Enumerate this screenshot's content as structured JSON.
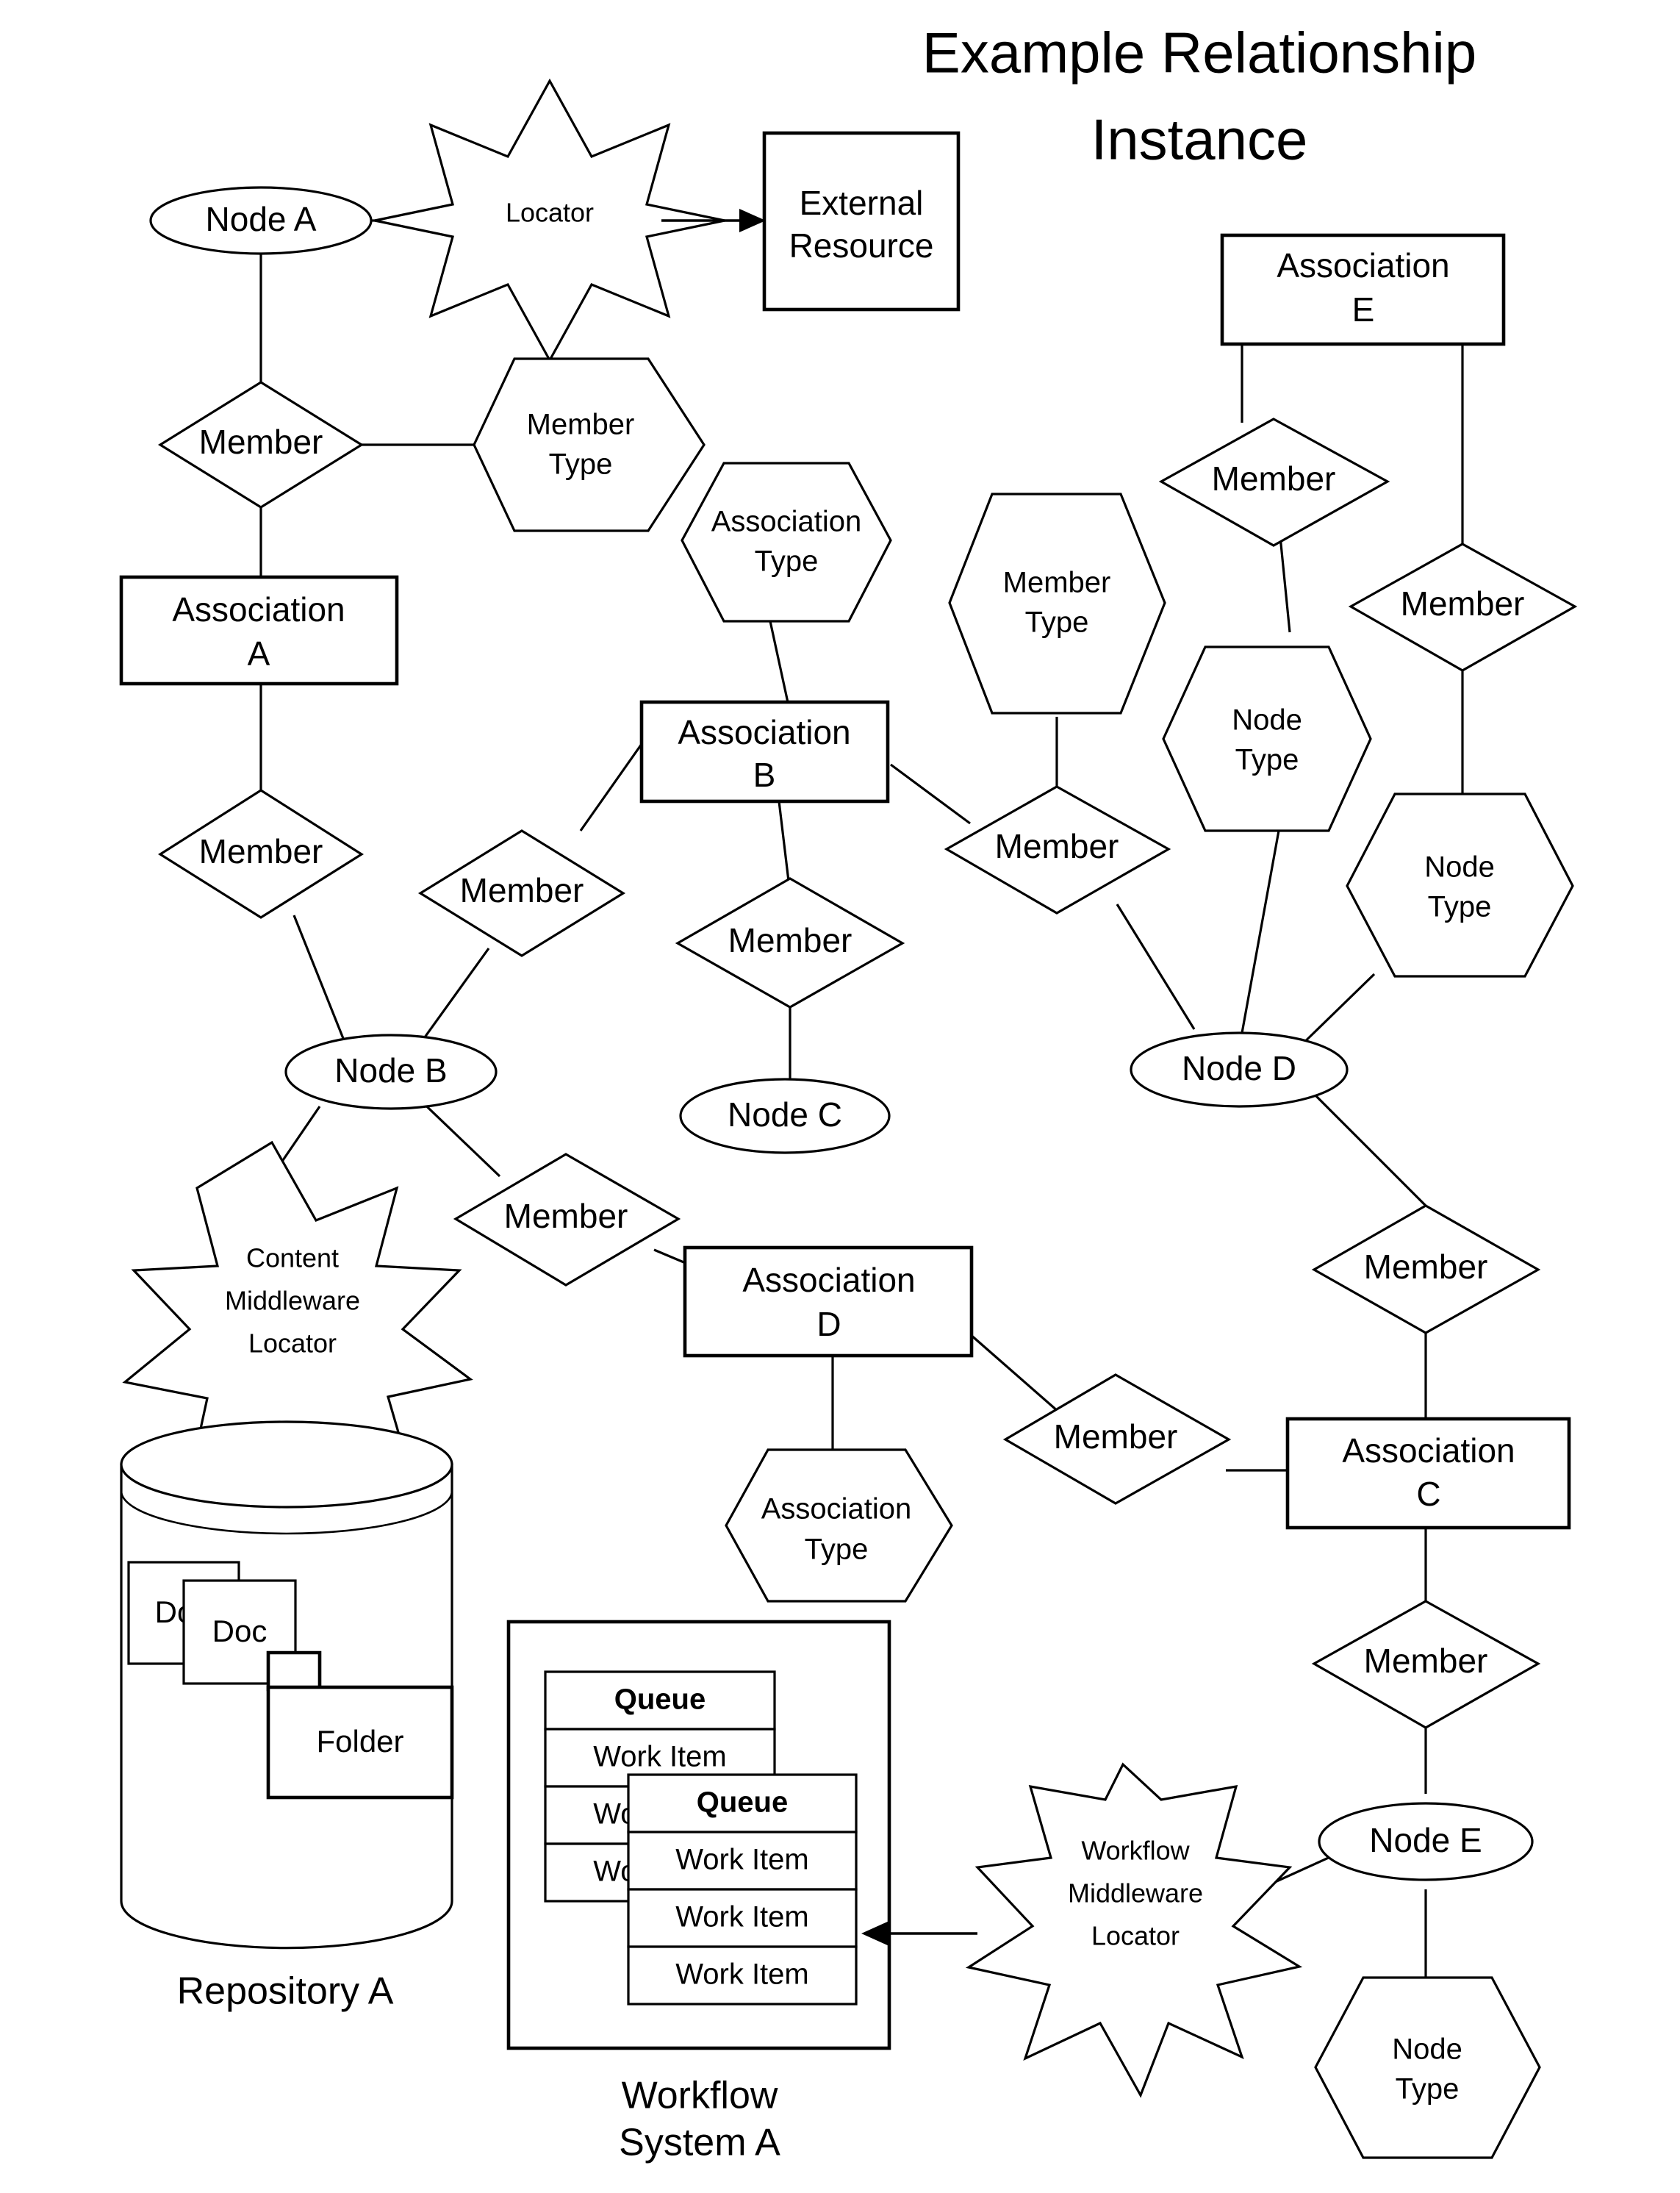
{
  "title": {
    "line1": "Example Relationship",
    "line2": "Instance"
  },
  "nodes": {
    "node_a": "Node A",
    "node_b": "Node B",
    "node_c": "Node C",
    "node_d": "Node D",
    "node_e": "Node E"
  },
  "associations": {
    "assoc_a_l1": "Association",
    "assoc_a_l2": "A",
    "assoc_b_l1": "Association",
    "assoc_b_l2": "B",
    "assoc_c_l1": "Association",
    "assoc_c_l2": "C",
    "assoc_d_l1": "Association",
    "assoc_d_l2": "D",
    "assoc_e_l1": "Association",
    "assoc_e_l2": "E"
  },
  "external_resource": {
    "line1": "External",
    "line2": "Resource"
  },
  "relationships": {
    "member_1": "Member",
    "member_2": "Member",
    "member_3": "Member",
    "member_4": "Member",
    "member_5": "Member",
    "member_6": "Member",
    "member_7": "Member",
    "member_8": "Member",
    "member_9": "Member",
    "member_10": "Member",
    "member_11": "Member"
  },
  "types": {
    "member_type_1_l1": "Member",
    "member_type_1_l2": "Type",
    "member_type_2_l1": "Member",
    "member_type_2_l2": "Type",
    "assoc_type_1_l1": "Association",
    "assoc_type_1_l2": "Type",
    "assoc_type_2_l1": "Association",
    "assoc_type_2_l2": "Type",
    "node_type_1_l1": "Node",
    "node_type_1_l2": "Type",
    "node_type_2_l1": "Node",
    "node_type_2_l2": "Type",
    "node_type_3_l1": "Node",
    "node_type_3_l2": "Type"
  },
  "locators": {
    "locator_top": "Locator",
    "content_mw_l1": "Content",
    "content_mw_l2": "Middleware",
    "content_mw_l3": "Locator",
    "workflow_mw_l1": "Workflow",
    "workflow_mw_l2": "Middleware",
    "workflow_mw_l3": "Locator"
  },
  "repository": {
    "caption": "Repository A",
    "doc_back": "Doc",
    "doc_front": "Doc",
    "folder": "Folder"
  },
  "workflow_system": {
    "caption_l1": "Workflow",
    "caption_l2": "System A",
    "queue_back": {
      "header": "Queue",
      "items": [
        "Work Item",
        "Work Item",
        "Work Item"
      ]
    },
    "queue_front": {
      "header": "Queue",
      "items": [
        "Work Item",
        "Work Item",
        "Work Item"
      ]
    }
  },
  "colors": {
    "stroke": "#000000",
    "fill": "#ffffff",
    "text": "#000000"
  }
}
